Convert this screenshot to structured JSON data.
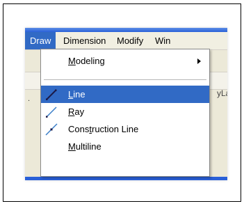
{
  "menubar": {
    "items": [
      {
        "label": "Draw",
        "active": true
      },
      {
        "label": "Dimension"
      },
      {
        "label": "Modify"
      },
      {
        "label": "Win"
      }
    ]
  },
  "background": {
    "right_text": "yLa",
    "left_tick": "."
  },
  "draw_menu": {
    "modeling": {
      "pre": "",
      "ul": "M",
      "post": "odeling",
      "has_submenu": true
    },
    "line": {
      "pre": "",
      "ul": "L",
      "post": "ine",
      "icon": "line-icon"
    },
    "ray": {
      "pre": "",
      "ul": "R",
      "post": "ay",
      "icon": "ray-icon"
    },
    "construction_line": {
      "pre": "Cons",
      "ul": "t",
      "post": "ruction Line",
      "icon": "construction-line-icon"
    },
    "multiline": {
      "pre": "",
      "ul": "M",
      "post": "ultiline"
    }
  },
  "colors": {
    "highlight": "#316ac5",
    "menubar_bg": "#f1efe2",
    "title_blue": "#2a60d8"
  }
}
